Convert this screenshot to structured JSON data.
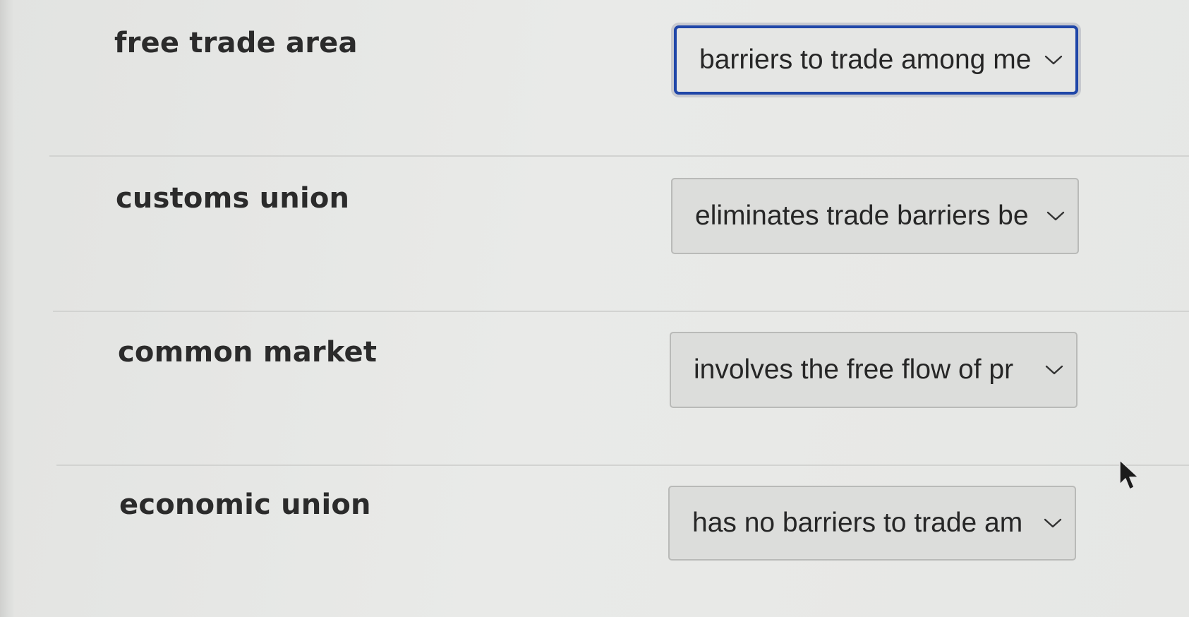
{
  "rows": [
    {
      "term": "free trade area",
      "selected": "barriers to trade among me",
      "focused": true
    },
    {
      "term": "customs union",
      "selected": "eliminates trade barriers be",
      "focused": false
    },
    {
      "term": "common market",
      "selected": "involves the free flow of pr",
      "focused": false
    },
    {
      "term": "economic union",
      "selected": "has no barriers to trade am",
      "focused": false
    }
  ],
  "icons": {
    "dropdown": "chevron-down-icon",
    "pointer": "mouse-cursor-icon"
  },
  "colors": {
    "focus_border": "#1f46a8",
    "select_background": "#dcdddb",
    "text": "#262626"
  }
}
